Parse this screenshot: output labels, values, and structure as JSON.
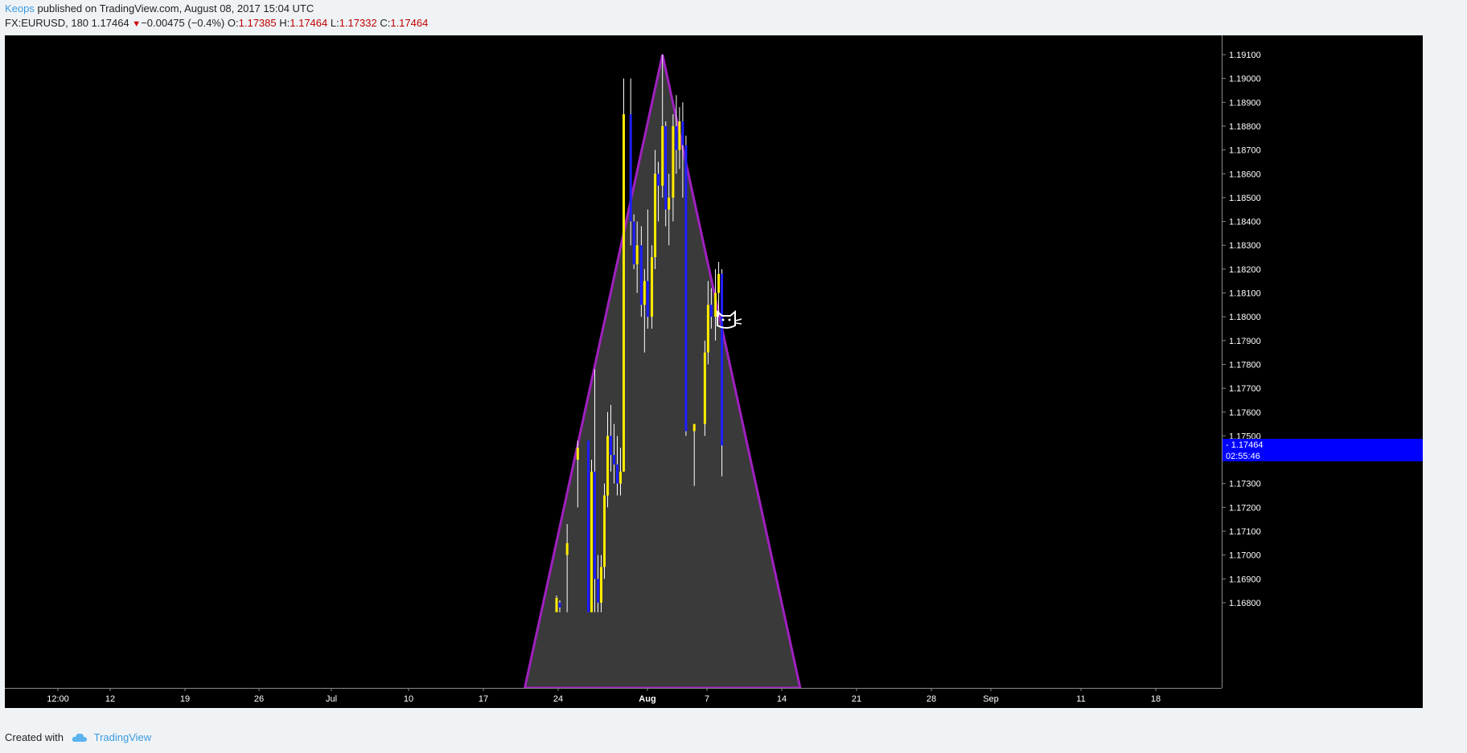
{
  "header": {
    "author": "Keops",
    "published": "published on TradingView.com, August 08, 2017 15:04 UTC",
    "symbol": "FX:EURUSD, 180",
    "last": "1.17464",
    "arrow": "▼",
    "change": "−0.00475 (−0.4%)",
    "o_label": "O:",
    "o_value": "1.17385",
    "h_label": "H:",
    "h_value": "1.17464",
    "l_label": "L:",
    "l_value": "1.17332",
    "c_label": "C:",
    "c_value": "1.17464"
  },
  "footer": {
    "created": "Created with",
    "brand": "TradingView"
  },
  "colors": {
    "background": "#000000",
    "up_bar": "#ffeb00",
    "down_bar": "#1e1eff",
    "wick": "#ffffff",
    "triangle_stroke": "#a020c0",
    "triangle_fill": "#3a3a3a",
    "price_label_bg": "#0000ff",
    "axis_line": "#888888"
  },
  "chart_data": {
    "type": "candlestick",
    "symbol": "FX:EURUSD",
    "interval": "180",
    "x_tick_labels": [
      "12:00",
      "12",
      "19",
      "26",
      "Jul",
      "10",
      "17",
      "24",
      "Aug",
      "7",
      "14",
      "21",
      "28",
      "Sep",
      "11",
      "18"
    ],
    "y_tick_labels": [
      "1.19100",
      "1.19000",
      "1.18900",
      "1.18800",
      "1.18700",
      "1.18600",
      "1.18500",
      "1.18400",
      "1.18300",
      "1.18200",
      "1.18100",
      "1.18000",
      "1.17900",
      "1.17800",
      "1.17700",
      "1.17600",
      "1.17500",
      "1.17300",
      "1.17200",
      "1.17100",
      "1.17000",
      "1.16900",
      "1.16800"
    ],
    "ylim": [
      1.1676,
      1.1918
    ],
    "last_price": "1.17464",
    "countdown": "02:55:46",
    "triangle": [
      {
        "x": "2017-07-21",
        "y": 1.1676
      },
      {
        "x": "2017-08-03",
        "y": 1.191
      },
      {
        "x": "2017-08-16",
        "y": 1.1676
      }
    ],
    "bars": [
      {
        "t": "2017-07-24",
        "o": 1.1676,
        "h": 1.1683,
        "l": 1.1676,
        "c": 1.1682
      },
      {
        "t": "2017-07-24",
        "o": 1.168,
        "h": 1.1681,
        "l": 1.1676,
        "c": 1.1678
      },
      {
        "t": "2017-07-25",
        "o": 1.17,
        "h": 1.1713,
        "l": 1.1676,
        "c": 1.1705
      },
      {
        "t": "2017-07-26",
        "o": 1.174,
        "h": 1.1748,
        "l": 1.172,
        "c": 1.1745
      },
      {
        "t": "2017-07-27",
        "o": 1.1748,
        "h": 1.1748,
        "l": 1.1676,
        "c": 1.1676
      },
      {
        "t": "2017-07-27",
        "o": 1.1676,
        "h": 1.174,
        "l": 1.1676,
        "c": 1.1735
      },
      {
        "t": "2017-07-27",
        "o": 1.1735,
        "h": 1.1778,
        "l": 1.1676,
        "c": 1.169
      },
      {
        "t": "2017-07-27",
        "o": 1.169,
        "h": 1.17,
        "l": 1.1676,
        "c": 1.168
      },
      {
        "t": "2017-07-28",
        "o": 1.168,
        "h": 1.17,
        "l": 1.1676,
        "c": 1.1695
      },
      {
        "t": "2017-07-28",
        "o": 1.1695,
        "h": 1.173,
        "l": 1.169,
        "c": 1.1725
      },
      {
        "t": "2017-07-28",
        "o": 1.1725,
        "h": 1.176,
        "l": 1.172,
        "c": 1.175
      },
      {
        "t": "2017-07-28",
        "o": 1.175,
        "h": 1.1763,
        "l": 1.1735,
        "c": 1.1742
      },
      {
        "t": "2017-07-28",
        "o": 1.1742,
        "h": 1.1755,
        "l": 1.173,
        "c": 1.1738
      },
      {
        "t": "2017-07-29",
        "o": 1.1738,
        "h": 1.175,
        "l": 1.1725,
        "c": 1.173
      },
      {
        "t": "2017-07-29",
        "o": 1.173,
        "h": 1.1745,
        "l": 1.1725,
        "c": 1.1735
      },
      {
        "t": "2017-07-29",
        "o": 1.1735,
        "h": 1.19,
        "l": 1.1735,
        "c": 1.1885
      },
      {
        "t": "2017-07-31",
        "o": 1.1885,
        "h": 1.19,
        "l": 1.183,
        "c": 1.184
      },
      {
        "t": "2017-07-31",
        "o": 1.184,
        "h": 1.1843,
        "l": 1.182,
        "c": 1.1822
      },
      {
        "t": "2017-07-31",
        "o": 1.1822,
        "h": 1.184,
        "l": 1.181,
        "c": 1.183
      },
      {
        "t": "2017-08-01",
        "o": 1.183,
        "h": 1.1838,
        "l": 1.18,
        "c": 1.1805
      },
      {
        "t": "2017-08-01",
        "o": 1.1805,
        "h": 1.182,
        "l": 1.1785,
        "c": 1.1815
      },
      {
        "t": "2017-08-01",
        "o": 1.1815,
        "h": 1.1845,
        "l": 1.1795,
        "c": 1.18
      },
      {
        "t": "2017-08-02",
        "o": 1.18,
        "h": 1.183,
        "l": 1.1795,
        "c": 1.1825
      },
      {
        "t": "2017-08-02",
        "o": 1.1825,
        "h": 1.187,
        "l": 1.182,
        "c": 1.186
      },
      {
        "t": "2017-08-02",
        "o": 1.186,
        "h": 1.1865,
        "l": 1.184,
        "c": 1.1855
      },
      {
        "t": "2017-08-03",
        "o": 1.1855,
        "h": 1.191,
        "l": 1.185,
        "c": 1.188
      },
      {
        "t": "2017-08-03",
        "o": 1.188,
        "h": 1.1882,
        "l": 1.1838,
        "c": 1.1845
      },
      {
        "t": "2017-08-03",
        "o": 1.1845,
        "h": 1.186,
        "l": 1.183,
        "c": 1.185
      },
      {
        "t": "2017-08-04",
        "o": 1.185,
        "h": 1.1885,
        "l": 1.184,
        "c": 1.188
      },
      {
        "t": "2017-08-04",
        "o": 1.188,
        "h": 1.1893,
        "l": 1.186,
        "c": 1.187
      },
      {
        "t": "2017-08-04",
        "o": 1.187,
        "h": 1.1888,
        "l": 1.1862,
        "c": 1.1882
      },
      {
        "t": "2017-08-04",
        "o": 1.1882,
        "h": 1.189,
        "l": 1.185,
        "c": 1.1872
      },
      {
        "t": "2017-08-05",
        "o": 1.1872,
        "h": 1.1876,
        "l": 1.175,
        "c": 1.1752
      },
      {
        "t": "2017-08-06",
        "o": 1.1752,
        "h": 1.1755,
        "l": 1.1729,
        "c": 1.1755
      },
      {
        "t": "2017-08-07",
        "o": 1.1755,
        "h": 1.179,
        "l": 1.175,
        "c": 1.1785
      },
      {
        "t": "2017-08-07",
        "o": 1.1785,
        "h": 1.1815,
        "l": 1.178,
        "c": 1.1805
      },
      {
        "t": "2017-08-07",
        "o": 1.1805,
        "h": 1.1812,
        "l": 1.1795,
        "c": 1.18
      },
      {
        "t": "2017-08-08",
        "o": 1.18,
        "h": 1.182,
        "l": 1.179,
        "c": 1.181
      },
      {
        "t": "2017-08-08",
        "o": 1.181,
        "h": 1.1823,
        "l": 1.18,
        "c": 1.1818
      },
      {
        "t": "2017-08-08",
        "o": 1.1818,
        "h": 1.182,
        "l": 1.1733,
        "c": 1.1746
      }
    ]
  }
}
